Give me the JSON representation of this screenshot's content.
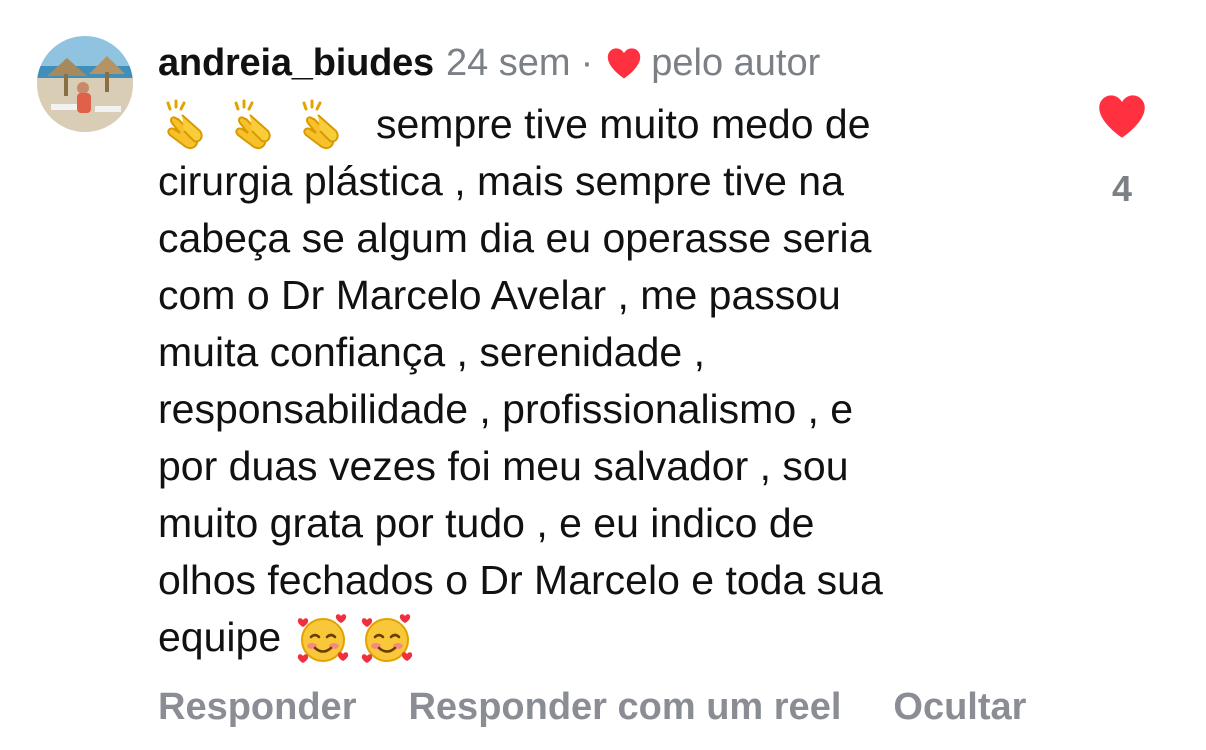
{
  "comment": {
    "author": "andreia_biudes",
    "time": "24 sem",
    "separator": "·",
    "author_like_label": "pelo autor",
    "lines": [
      "sempre tive muito medo de",
      "cirurgia plástica , mais sempre tive na",
      "cabeça se algum dia eu operasse seria",
      "com o Dr Marcelo Avelar , me passou",
      "muita confiança , serenidade ,",
      "responsabilidade , profissionalismo , e",
      "por duas vezes foi meu salvador , sou",
      "muito grata por tudo , e eu indico de",
      "olhos fechados o Dr Marcelo e toda sua",
      "equipe"
    ],
    "leading_emojis": [
      "clapping-hands-emoji",
      "clapping-hands-emoji",
      "clapping-hands-emoji"
    ],
    "trailing_emojis": [
      "smiling-face-with-hearts-emoji",
      "smiling-face-with-hearts-emoji"
    ]
  },
  "likes": {
    "count": "4",
    "heart_color": "#ff3040"
  },
  "actions": {
    "reply": "Responder",
    "reply_reel": "Responder com um reel",
    "hide": "Ocultar"
  },
  "colors": {
    "text": "#111111",
    "muted": "#7b7f86",
    "action": "#8a8d93",
    "heart": "#ff3040"
  }
}
